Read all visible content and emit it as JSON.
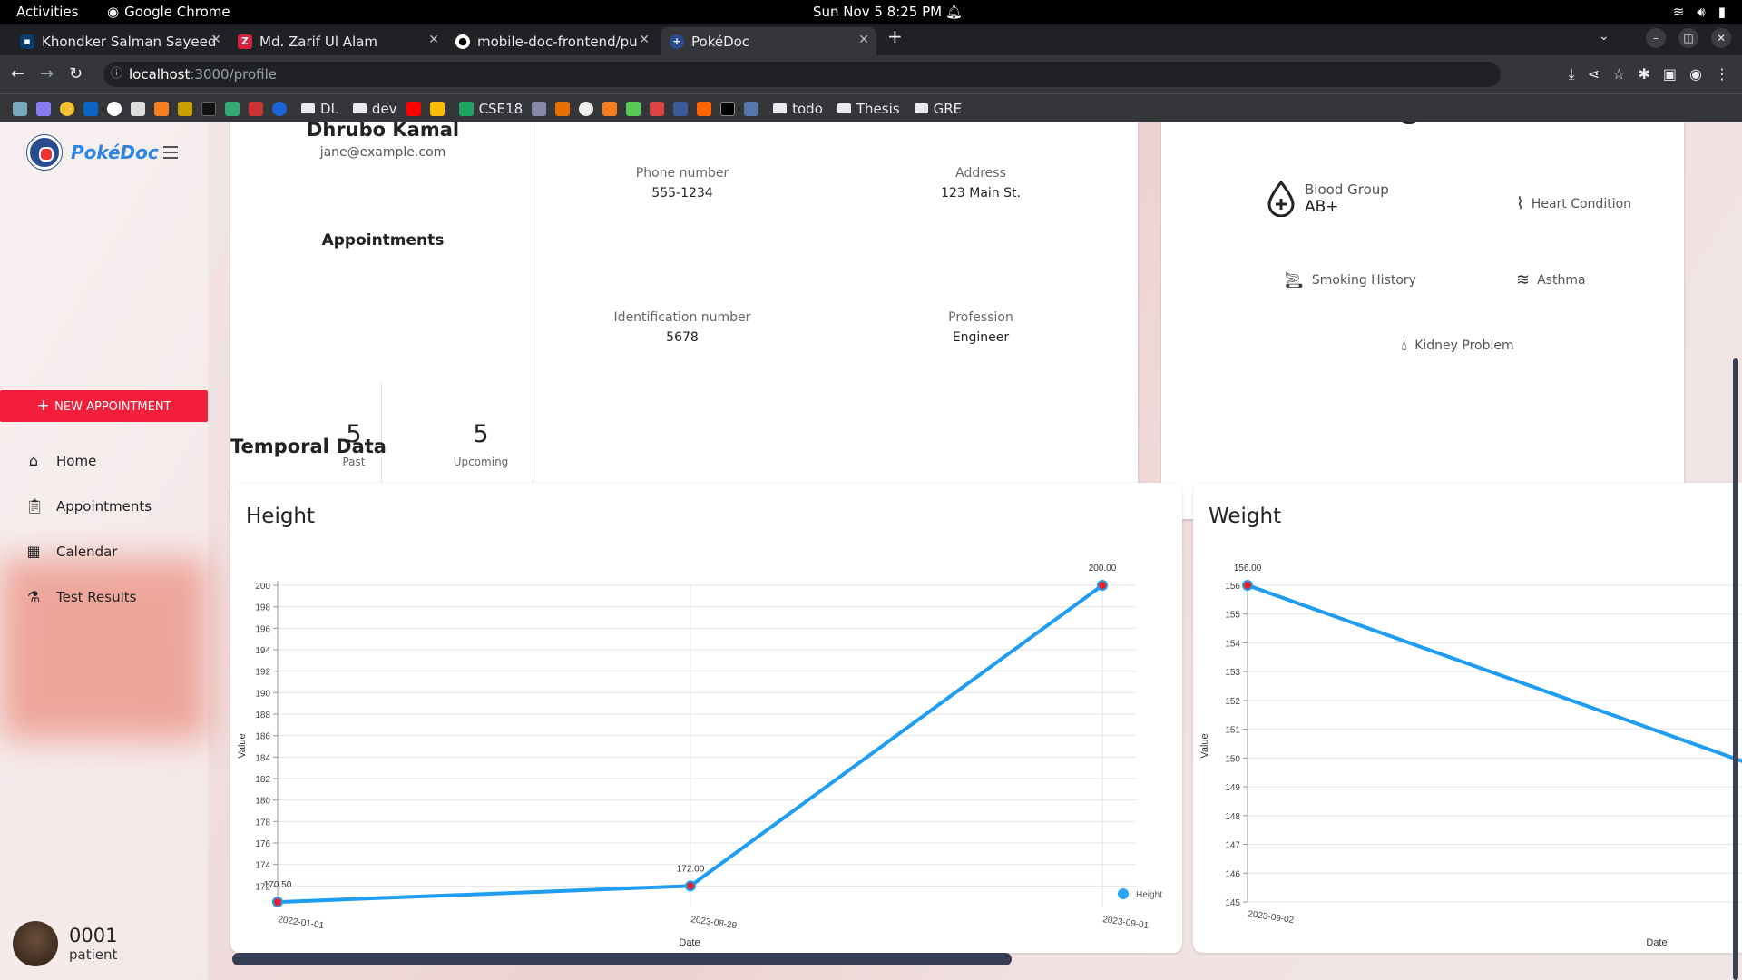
{
  "system": {
    "activities": "Activities",
    "app": "Google Chrome",
    "clock": "Sun Nov 5  8:25 PM"
  },
  "tabs": [
    {
      "label": "Khondker Salman Sayeed"
    },
    {
      "label": "Md. Zarif Ul Alam"
    },
    {
      "label": "mobile-doc-frontend/pu"
    },
    {
      "label": "PokéDoc"
    }
  ],
  "browser": {
    "url_host": "localhost",
    "url_path": ":3000/profile"
  },
  "bookmarks": [
    {
      "label": "DL"
    },
    {
      "label": "dev"
    },
    {
      "label": "CSE18"
    },
    {
      "label": "todo"
    },
    {
      "label": "Thesis"
    },
    {
      "label": "GRE"
    }
  ],
  "sidebar": {
    "brand": "PokéDoc",
    "new_appointment": "NEW APPOINTMENT",
    "items": [
      {
        "label": "Home"
      },
      {
        "label": "Appointments"
      },
      {
        "label": "Calendar"
      },
      {
        "label": "Test Results"
      }
    ],
    "user_id": "0001",
    "user_role": "patient"
  },
  "profile": {
    "name": "Dhrubo Kamal",
    "email": "jane@example.com",
    "appointments_title": "Appointments",
    "past_count": "5",
    "past_label": "Past",
    "upcoming_count": "5",
    "upcoming_label": "Upcoming",
    "phone_label": "Phone number",
    "phone": "555-1234",
    "address_label": "Address",
    "address": "123 Main St.",
    "id_label": "Identification number",
    "id_number": "5678",
    "profession_label": "Profession",
    "profession": "Engineer"
  },
  "health": {
    "blood_group_label": "Blood Group",
    "blood_group": "AB+",
    "heart": "Heart Condition",
    "smoking": "Smoking History",
    "asthma": "Asthma",
    "kidney": "Kidney Problem"
  },
  "section_title": "Temporal Data",
  "chart_data": [
    {
      "type": "line",
      "title": "Height",
      "xlabel": "Date",
      "ylabel": "Value",
      "x": [
        "2022-01-01",
        "2023-08-29",
        "2023-09-01"
      ],
      "series": [
        {
          "name": "Height",
          "values": [
            170.5,
            172.0,
            200.0
          ]
        }
      ],
      "point_labels": [
        "170.50",
        "172.00",
        "200.00"
      ],
      "ylim": [
        170,
        200
      ],
      "yticks": [
        172,
        174,
        176,
        178,
        180,
        182,
        184,
        186,
        188,
        190,
        192,
        194,
        196,
        198,
        200
      ],
      "ytick_labels": [
        "172",
        "174",
        "176",
        "178",
        "180",
        "182",
        "184",
        "186",
        "188",
        "190",
        "192",
        "194",
        "196",
        "198",
        "200"
      ],
      "legend": "bottom-right",
      "grid": true,
      "line_color": "#1e9df2",
      "point_color": "#e8202a"
    },
    {
      "type": "line",
      "title": "Weight",
      "xlabel": "Date",
      "ylabel": "Value",
      "x": [
        "2023-09-02"
      ],
      "series": [
        {
          "values": [
            156.0,
            149.5
          ]
        }
      ],
      "point_labels": [
        "156.00"
      ],
      "ylim": [
        145,
        156
      ],
      "yticks": [
        145,
        146,
        147,
        148,
        149,
        150,
        151,
        152,
        153,
        154,
        155,
        156
      ],
      "ytick_labels": [
        "145",
        "146",
        "147",
        "148",
        "149",
        "150",
        "151",
        "152",
        "153",
        "154",
        "155",
        "156"
      ],
      "grid": true,
      "line_color": "#1e9df2",
      "point_color": "#e8202a"
    }
  ]
}
